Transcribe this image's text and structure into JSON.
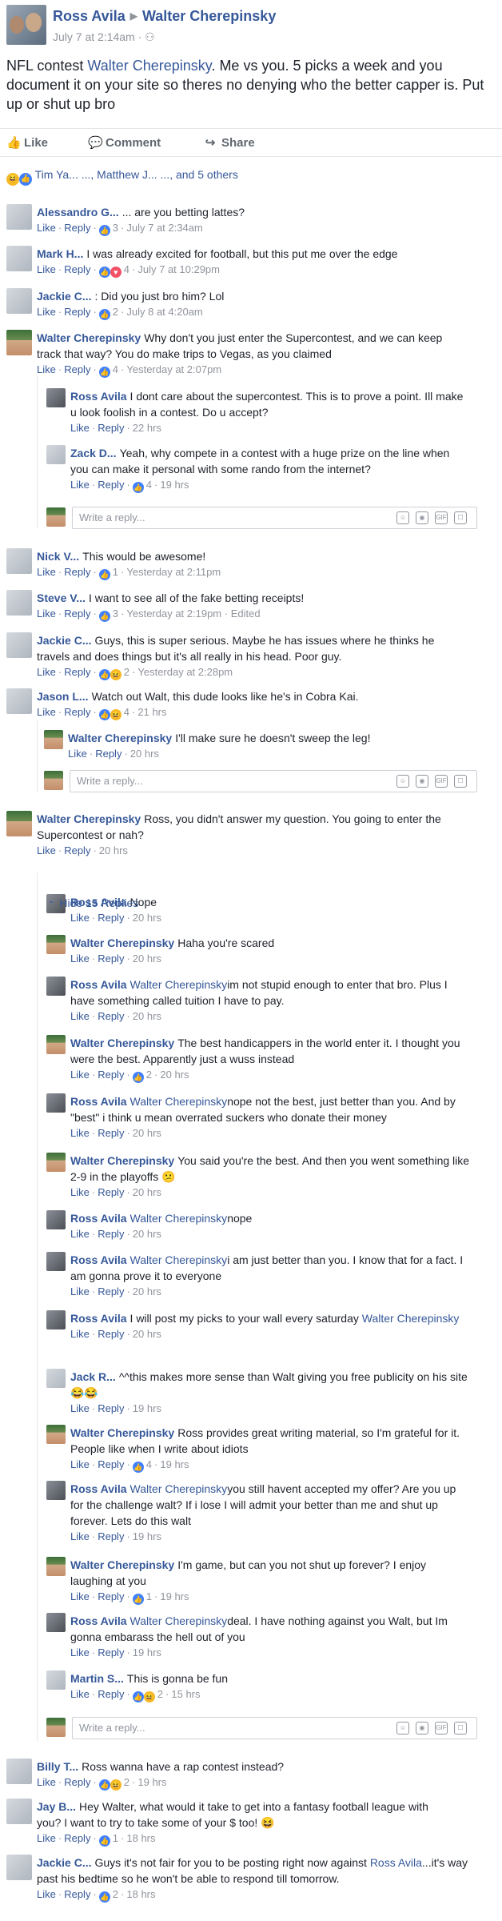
{
  "post": {
    "author": "Ross Avila",
    "target": "Walter Cherepinsky",
    "timestamp": "July 7 at 2:14am",
    "text_before": "NFL contest ",
    "text_mention": "Walter Cherepinsky",
    "text_after": ". Me vs you. 5 picks a week and you document it on your site so theres no denying who the better capper is. Put up or shut up bro",
    "actions": {
      "like": "Like",
      "comment": "Comment",
      "share": "Share"
    },
    "reactions_text": "Tim Ya... ..., Matthew J... ..., and 5 others"
  },
  "common": {
    "like": "Like",
    "reply": "Reply",
    "write_reply": "Write a reply...",
    "hide_replies": "Hide 15 Replies"
  },
  "comments": [
    {
      "name": "Alessandro G...",
      "text": "... are you betting lattes?",
      "count": "3",
      "time": "July 7 at 2:34am"
    },
    {
      "name": "Mark H...",
      "text": "I was already excited for football, but this put me over the edge",
      "count": "4",
      "time": "July 7 at 10:29pm"
    },
    {
      "name": "Jackie C...",
      "text": ": Did you just bro him? Lol",
      "count": "2",
      "time": "July 8 at 4:20am"
    },
    {
      "name": "Walter Cherepinsky",
      "text": "Why don't you just enter the Supercontest, and we can keep track that way? You do make trips to Vegas, as you claimed",
      "count": "4",
      "time": "Yesterday at 2:07pm"
    },
    {
      "name": "Ross Avila",
      "text": "I dont care about the supercontest. This is to prove a point. Ill make u look foolish in a contest. Do u accept?",
      "count": "",
      "time": "22 hrs"
    },
    {
      "name": "Zack D...",
      "text": "Yeah, why compete in a contest with a huge prize on the line when you can make it personal with some rando from the internet?",
      "count": "4",
      "time": "19 hrs"
    },
    {
      "name": "Nick V...",
      "text": "This would be awesome!",
      "count": "1",
      "time": "Yesterday at 2:11pm"
    },
    {
      "name": "Steve V...",
      "text": "I want to see all of the fake betting receipts!",
      "count": "3",
      "time": "Yesterday at 2:19pm · Edited"
    },
    {
      "name": "Jackie C...",
      "text": "Guys, this is super serious. Maybe he has issues where he thinks he travels and does things but it's all really in his head. Poor guy.",
      "count": "2",
      "time": "Yesterday at 2:28pm"
    },
    {
      "name": "Jason L...",
      "text": "Watch out Walt, this dude looks like he's in Cobra Kai.",
      "count": "4",
      "time": "21 hrs"
    },
    {
      "name": "Walter Cherepinsky",
      "text": "I'll make sure he doesn't sweep the leg!",
      "count": "",
      "time": "20 hrs"
    },
    {
      "name": "Walter Cherepinsky",
      "text": "Ross, you didn't answer my question. You going to enter the Supercontest or nah?",
      "count": "",
      "time": "20 hrs"
    },
    {
      "name": "Ross Avila",
      "text": "Nope",
      "count": "",
      "time": "20 hrs"
    },
    {
      "name": "Walter Cherepinsky",
      "text": "Haha you're scared",
      "count": "",
      "time": "20 hrs"
    },
    {
      "name": "Ross Avila",
      "mention": "Walter Cherepinsky",
      "text": "im not stupid enough to enter that bro. Plus I have something called tuition I have to pay.",
      "count": "",
      "time": "20 hrs"
    },
    {
      "name": "Walter Cherepinsky",
      "text": "The best handicappers in the world enter it. I thought you were the best. Apparently just a wuss instead",
      "count": "2",
      "time": "20 hrs"
    },
    {
      "name": "Ross Avila",
      "mention": "Walter Cherepinsky",
      "text": "nope not the best, just better than you. And by \"best\" i think u mean overrated suckers who donate their money",
      "count": "",
      "time": "20 hrs"
    },
    {
      "name": "Walter Cherepinsky",
      "text": "You said you're the best. And then you went something like 2-9 in the playoffs 😕",
      "count": "",
      "time": "20 hrs"
    },
    {
      "name": "Ross Avila",
      "mention": "Walter Cherepinsky",
      "text": "nope",
      "count": "",
      "time": "20 hrs"
    },
    {
      "name": "Ross Avila",
      "mention": "Walter Cherepinsky",
      "text": "i am just better than you. I know that for a fact. I am gonna prove it to everyone",
      "count": "",
      "time": "20 hrs"
    },
    {
      "name": "Ross Avila",
      "text": "I will post my picks to your wall every saturday ",
      "mention_after": "Walter Cherepinsky",
      "count": "",
      "time": "20 hrs"
    },
    {
      "name": "Jack R...",
      "text": "^^this makes more sense than Walt giving you free publicity on his site 😂😂",
      "count": "",
      "time": "19 hrs"
    },
    {
      "name": "Walter Cherepinsky",
      "text": "Ross provides great writing material, so I'm grateful for it. People like when I write about idiots",
      "count": "4",
      "time": "19 hrs"
    },
    {
      "name": "Ross Avila",
      "mention": "Walter Cherepinsky",
      "text": "you still havent accepted my offer? Are you up for the challenge walt? If i lose I will admit your better than me and shut up forever. Lets do this walt",
      "count": "",
      "time": "19 hrs"
    },
    {
      "name": "Walter Cherepinsky",
      "text": "I'm game, but can you not shut up forever? I enjoy laughing at you",
      "count": "1",
      "time": "19 hrs"
    },
    {
      "name": "Ross Avila",
      "mention": "Walter Cherepinsky",
      "text": "deal. I have nothing against you Walt, but Im gonna embarass the hell out of you",
      "count": "",
      "time": "19 hrs"
    },
    {
      "name": "Martin S...",
      "text": "This is gonna be fun",
      "count": "2",
      "time": "15 hrs"
    },
    {
      "name": "Billy T...",
      "text": "Ross wanna have a rap contest instead?",
      "count": "2",
      "time": "19 hrs"
    },
    {
      "name": "Jay B...",
      "text": "Hey Walter, what would it take to get into a fantasy football league with you? I want to try to take some of your $ too! 😆",
      "count": "1",
      "time": "18 hrs"
    },
    {
      "name": "Jackie C...",
      "text": "Guys it's not fair for you to be posting right now against ",
      "mention_after": "Ross Avila",
      "text_after": "...it's way past his bedtime so he won't be able to respond till tomorrow.",
      "count": "2",
      "time": "18 hrs"
    }
  ]
}
